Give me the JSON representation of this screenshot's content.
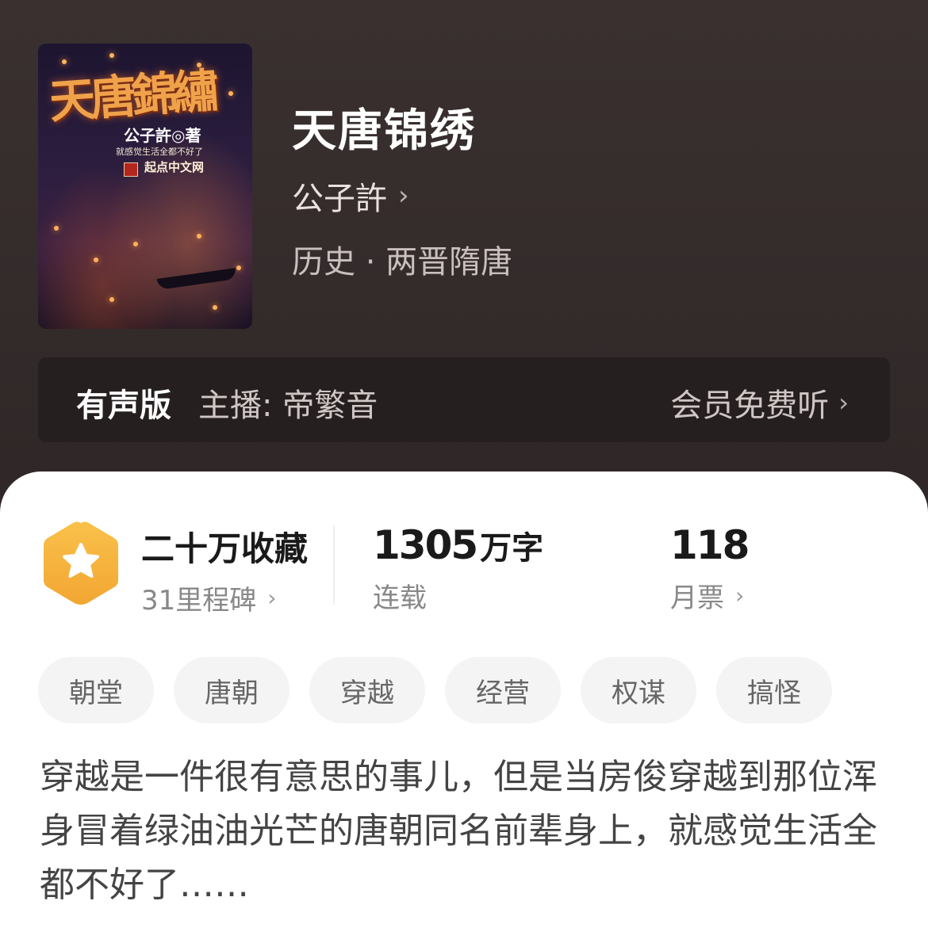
{
  "book": {
    "title": "天唐锦绣",
    "author": "公子許",
    "genre": "历史 · 两晋隋唐"
  },
  "cover": {
    "title_text": "天唐錦繡",
    "author_text": "公子許◎著",
    "tagline": "就感觉生活全都不好了",
    "publisher": "起点中文网"
  },
  "audio": {
    "label": "有声版",
    "host": "主播: 帝繁音",
    "cta": "会员免费听"
  },
  "stats": {
    "collection": {
      "primary": "二十万收藏",
      "secondary": "31里程碑"
    },
    "words": {
      "number": "1305",
      "unit": "万字",
      "status": "连载"
    },
    "votes": {
      "number": "118",
      "label": "月票"
    }
  },
  "tags": [
    "朝堂",
    "唐朝",
    "穿越",
    "经营",
    "权谋",
    "搞怪"
  ],
  "synopsis": "穿越是一件很有意思的事儿，但是当房俊穿越到那位浑身冒着绿油油光芒的唐朝同名前辈身上，就感觉生活全都不好了……",
  "colors": {
    "header_bg": "#352c2c",
    "badge_orange": "#f5b740",
    "panel_bg": "#ffffff"
  },
  "icons": {
    "author_chevron": "chevron-right-icon",
    "audio_chevron": "chevron-right-icon",
    "badge": "star-hexagon-icon"
  }
}
